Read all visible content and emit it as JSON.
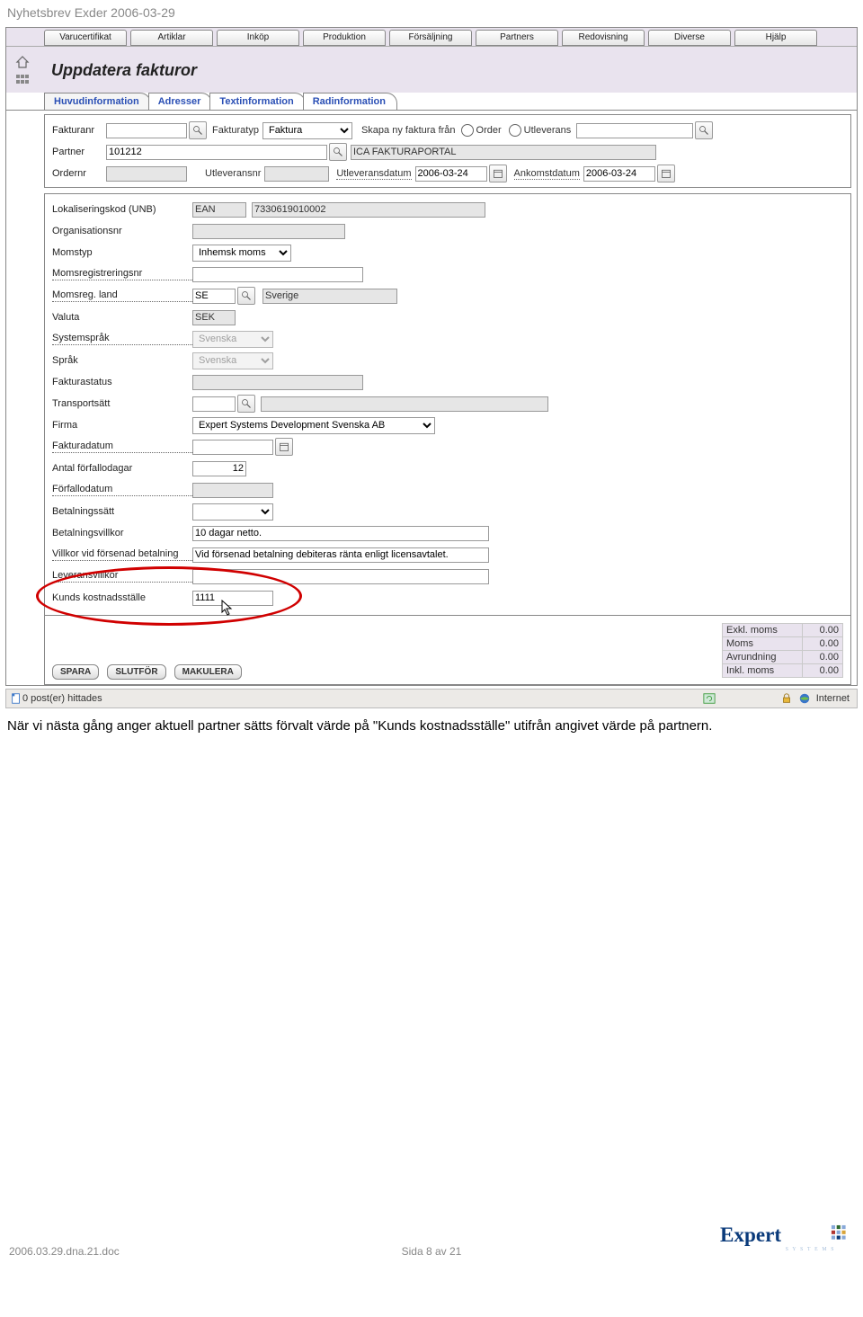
{
  "doc": {
    "header": "Nyhetsbrev Exder 2006-03-29"
  },
  "mainmenu": [
    "Varucertifikat",
    "Artiklar",
    "Inköp",
    "Produktion",
    "Försäljning",
    "Partners",
    "Redovisning",
    "Diverse",
    "Hjälp"
  ],
  "title": "Uppdatera fakturor",
  "subtabs": [
    "Huvudinformation",
    "Adresser",
    "Textinformation",
    "Radinformation"
  ],
  "active_subtab": 0,
  "row1": {
    "fakturanr_lbl": "Fakturanr",
    "fakturatyp_lbl": "Fakturatyp",
    "fakturatyp_val": "Faktura",
    "skapa_lbl": "Skapa ny faktura från",
    "opt_order": "Order",
    "opt_utl": "Utleverans"
  },
  "row2": {
    "partner_lbl": "Partner",
    "partner_code": "101212",
    "partner_name": "ICA FAKTURAPORTAL"
  },
  "row3": {
    "ordernr_lbl": "Ordernr",
    "utleveransnr_lbl": "Utleveransnr",
    "utleveransdatum_lbl": "Utleveransdatum",
    "utleveransdatum_val": "2006-03-24",
    "ankomstdatum_lbl": "Ankomstdatum",
    "ankomstdatum_val": "2006-03-24"
  },
  "fields": {
    "lok_lbl": "Lokaliseringskod (UNB)",
    "lok_type": "EAN",
    "lok_val": "7330619010002",
    "org_lbl": "Organisationsnr",
    "momstyp_lbl": "Momstyp",
    "momstyp_val": "Inhemsk moms",
    "momsreg_lbl": "Momsregistreringsnr",
    "momsland_lbl": "Momsreg. land",
    "momsland_code": "SE",
    "momsland_name": "Sverige",
    "valuta_lbl": "Valuta",
    "valuta_val": "SEK",
    "sysprak_lbl": "Systemspråk",
    "sysprak_val": "Svenska",
    "sprak_lbl": "Språk",
    "sprak_val": "Svenska",
    "fstatus_lbl": "Fakturastatus",
    "trans_lbl": "Transportsätt",
    "firma_lbl": "Firma",
    "firma_val": "Expert Systems Development Svenska AB",
    "fdatum_lbl": "Fakturadatum",
    "antal_lbl": "Antal förfallodagar",
    "antal_val": "12",
    "forfall_lbl": "Förfallodatum",
    "bets_lbl": "Betalningssätt",
    "betv_lbl": "Betalningsvillkor",
    "betv_val": "10 dagar netto.",
    "villkor_lbl": "Villkor vid försenad betalning",
    "villkor_val": "Vid försenad betalning debiteras ränta enligt licensavtalet.",
    "lev_lbl": "Leveransvillkor",
    "kund_lbl": "Kunds kostnadsställe",
    "kund_val": "1111"
  },
  "buttons": {
    "spara": "SPARA",
    "slutfor": "SLUTFÖR",
    "makulera": "MAKULERA"
  },
  "totals": {
    "exkl_lbl": "Exkl. moms",
    "exkl_val": "0.00",
    "moms_lbl": "Moms",
    "moms_val": "0.00",
    "avr_lbl": "Avrundning",
    "avr_val": "0.00",
    "inkl_lbl": "Inkl. moms",
    "inkl_val": "0.00"
  },
  "statusbar": {
    "left": "0 post(er) hittades",
    "right": "Internet"
  },
  "caption": "När vi nästa gång anger aktuell partner sätts förvalt värde på \"Kunds kostnadsställe\" utifrån angivet värde på partnern.",
  "footer": {
    "left": "2006.03.29.dna.21.doc",
    "center": "Sida 8 av 21",
    "logo_text": "Expert",
    "logo_sub": "S Y S T E M S"
  }
}
